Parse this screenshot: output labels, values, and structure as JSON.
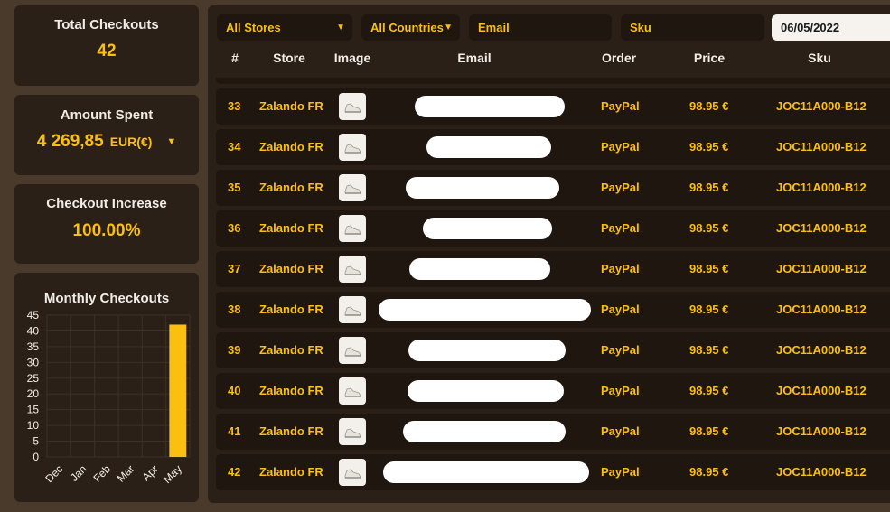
{
  "stats": {
    "total_checkouts_label": "Total Checkouts",
    "total_checkouts_value": "42",
    "amount_spent_label": "Amount Spent",
    "amount_spent_value": "4 269,85",
    "amount_spent_currency": "EUR(€)",
    "checkout_increase_label": "Checkout Increase",
    "checkout_increase_value": "100.00%"
  },
  "chart_data": {
    "type": "bar",
    "title": "Monthly Checkouts",
    "categories": [
      "Dec",
      "Jan",
      "Feb",
      "Mar",
      "Apr",
      "May"
    ],
    "values": [
      0,
      0,
      0,
      0,
      0,
      42
    ],
    "yticks": [
      0,
      5,
      10,
      15,
      20,
      25,
      30,
      35,
      40,
      45
    ],
    "ylim": [
      0,
      45
    ],
    "grid": true,
    "bar_color": "#fbbf0f"
  },
  "filters": {
    "store": "All Stores",
    "country": "All Countries",
    "email_placeholder": "Email",
    "sku_placeholder": "Sku",
    "date": "06/05/2022"
  },
  "table": {
    "columns": [
      "#",
      "Store",
      "Image",
      "Email",
      "Order",
      "Price",
      "Sku"
    ],
    "rows": [
      {
        "id": "33",
        "store": "Zalando FR",
        "order": "PayPal",
        "price": "98.95 €",
        "sku": "JOC11A000-B12"
      },
      {
        "id": "34",
        "store": "Zalando FR",
        "order": "PayPal",
        "price": "98.95 €",
        "sku": "JOC11A000-B12"
      },
      {
        "id": "35",
        "store": "Zalando FR",
        "order": "PayPal",
        "price": "98.95 €",
        "sku": "JOC11A000-B12"
      },
      {
        "id": "36",
        "store": "Zalando FR",
        "order": "PayPal",
        "price": "98.95 €",
        "sku": "JOC11A000-B12"
      },
      {
        "id": "37",
        "store": "Zalando FR",
        "order": "PayPal",
        "price": "98.95 €",
        "sku": "JOC11A000-B12"
      },
      {
        "id": "38",
        "store": "Zalando FR",
        "order": "PayPal",
        "price": "98.95 €",
        "sku": "JOC11A000-B12"
      },
      {
        "id": "39",
        "store": "Zalando FR",
        "order": "PayPal",
        "price": "98.95 €",
        "sku": "JOC11A000-B12"
      },
      {
        "id": "40",
        "store": "Zalando FR",
        "order": "PayPal",
        "price": "98.95 €",
        "sku": "JOC11A000-B12"
      },
      {
        "id": "41",
        "store": "Zalando FR",
        "order": "PayPal",
        "price": "98.95 €",
        "sku": "JOC11A000-B12"
      },
      {
        "id": "42",
        "store": "Zalando FR",
        "order": "PayPal",
        "price": "98.95 €",
        "sku": "JOC11A000-B12"
      }
    ]
  },
  "icons": {
    "dropdown": "chevron-down-icon",
    "product": "sneaker-icon"
  }
}
